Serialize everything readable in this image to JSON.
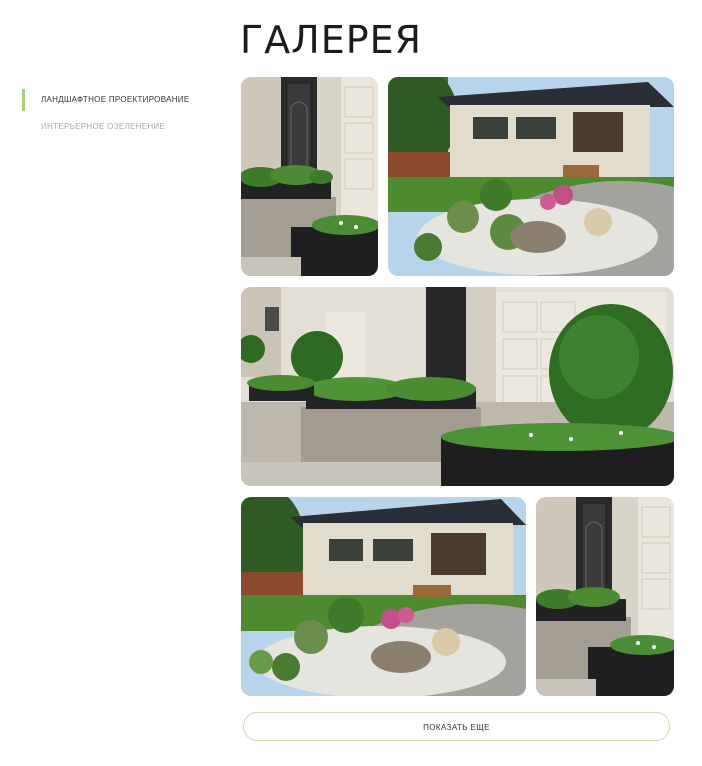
{
  "page": {
    "title": "ГАЛЕРЕЯ"
  },
  "sidebar": {
    "items": [
      {
        "label": "ЛАНДШАФТНОЕ ПРОЕКТИРОВАНИЕ",
        "active": true
      },
      {
        "label": "ИНТЕРЬЕРНОЕ ОЗЕЛЕНЕНИЕ",
        "active": false
      }
    ],
    "accent_color": "#a8d27a"
  },
  "gallery": {
    "images": [
      {
        "name": "gallery-image-door-planter"
      },
      {
        "name": "gallery-image-house-garden"
      },
      {
        "name": "gallery-image-garage-topiary"
      },
      {
        "name": "gallery-image-house-garden-2"
      },
      {
        "name": "gallery-image-door-planter-2"
      }
    ]
  },
  "show_more": {
    "label": "ПОКАЗАТЬ ЕЩЕ"
  }
}
